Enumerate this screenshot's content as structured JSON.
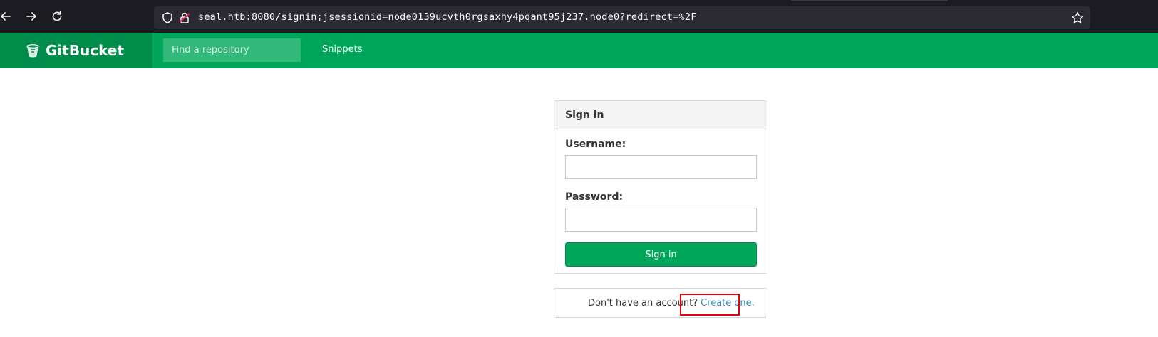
{
  "browser": {
    "url": "seal.htb:8080/signin;jsessionid=node0139ucvth0rgsaxhy4pqant95j237.node0?redirect=%2F"
  },
  "header": {
    "brand": "GitBucket",
    "search_placeholder": "Find a repository",
    "nav_snippets": "Snippets"
  },
  "signin": {
    "title": "Sign in",
    "username_label": "Username:",
    "username_value": "",
    "password_label": "Password:",
    "password_value": "",
    "button_label": "Sign in"
  },
  "account": {
    "prompt": "Don't have an account?",
    "create_link": "Create one."
  },
  "colors": {
    "brand_green": "#00a65a",
    "brand_dark_green": "#008d4c",
    "link_blue": "#3c8dbc",
    "highlight_red": "#e8000b"
  },
  "icons": [
    "back-arrow-icon",
    "forward-arrow-icon",
    "reload-icon",
    "shield-icon",
    "insecure-lock-icon",
    "bookmark-star-icon",
    "gitbucket-logo-icon"
  ]
}
